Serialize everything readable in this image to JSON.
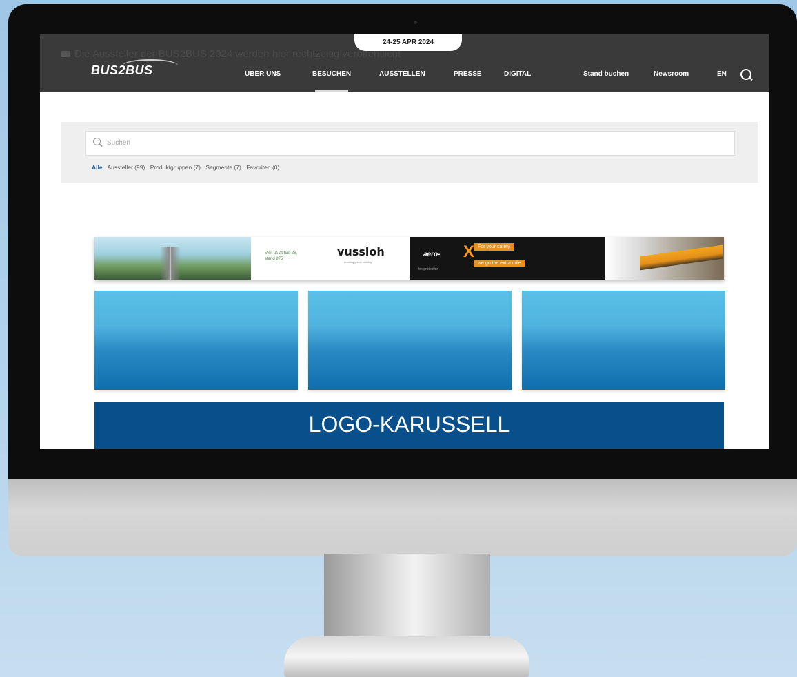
{
  "header": {
    "notice_text": "Die Aussteller der BUS2BUS 2024 werden hier rechtzeitig veröffentlicht",
    "date": "24-25 APR 2024",
    "logo": "BUS2BUS",
    "nav": [
      {
        "label": "ÜBER UNS"
      },
      {
        "label": "BESUCHEN"
      },
      {
        "label": "AUSSTELLEN"
      },
      {
        "label": "PRESSE"
      },
      {
        "label": "DIGITAL"
      }
    ],
    "utility": {
      "stand": "Stand buchen",
      "newsroom": "Newsroom",
      "lang": "EN"
    }
  },
  "search": {
    "placeholder": "Suchen",
    "filters": [
      {
        "label": "Alle"
      },
      {
        "label": "Aussteller (99)"
      },
      {
        "label": "Produktgruppen (7)"
      },
      {
        "label": "Segmente (7)"
      },
      {
        "label": "Favoriten (0)"
      }
    ]
  },
  "banner": {
    "visit_text": "Visit us at hall 26, stand 975",
    "brand": "vussloh",
    "brand_tag": "creating green mobility",
    "aero_logo": "aero-",
    "aero_x": "X",
    "aero_sub": "fire protection",
    "aero_tag1": "For your safety",
    "aero_tag2": "we go the extra mile"
  },
  "carousel": {
    "label": "LOGO-KARUSSELL"
  }
}
